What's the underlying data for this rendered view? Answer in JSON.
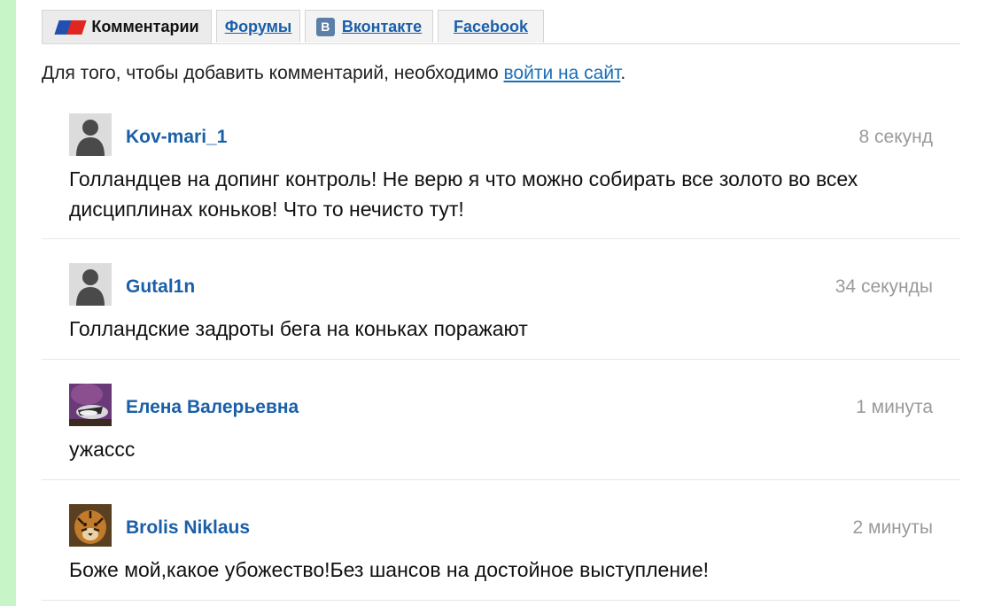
{
  "tabs": [
    {
      "label": "Комментарии",
      "active": true
    },
    {
      "label": "Форумы",
      "active": false
    },
    {
      "label": "Вконтакте",
      "active": false,
      "icon": "В"
    },
    {
      "label": "Facebook",
      "active": false
    }
  ],
  "notice": {
    "text": "Для того, чтобы добавить комментарий, необходимо ",
    "link": "войти на сайт",
    "suffix": "."
  },
  "comments": [
    {
      "author": "Kov-mari_1",
      "time": "8 секунд",
      "text": "Голландцев на допинг контроль! Не верю я что можно собирать все золото во всех дисциплинах коньков! Что то нечисто тут!",
      "avatar": "default-user-icon"
    },
    {
      "author": "Gutal1n",
      "time": "34 секунды",
      "text": "Голландские задроты бега на коньках поражают",
      "avatar": "default-user-icon"
    },
    {
      "author": "Елена Валерьевна",
      "time": "1 минута",
      "text": "ужассс",
      "avatar": "photo-avatar"
    },
    {
      "author": "Brolis Niklaus",
      "time": "2 минуты",
      "text": "Боже мой,какое убожество!Без шансов на достойное выступление!",
      "avatar": "tiger-photo-avatar"
    }
  ],
  "colors": {
    "link": "#1a5fa8",
    "sidebar": "#c8f5c8",
    "time": "#9a9a9a"
  }
}
